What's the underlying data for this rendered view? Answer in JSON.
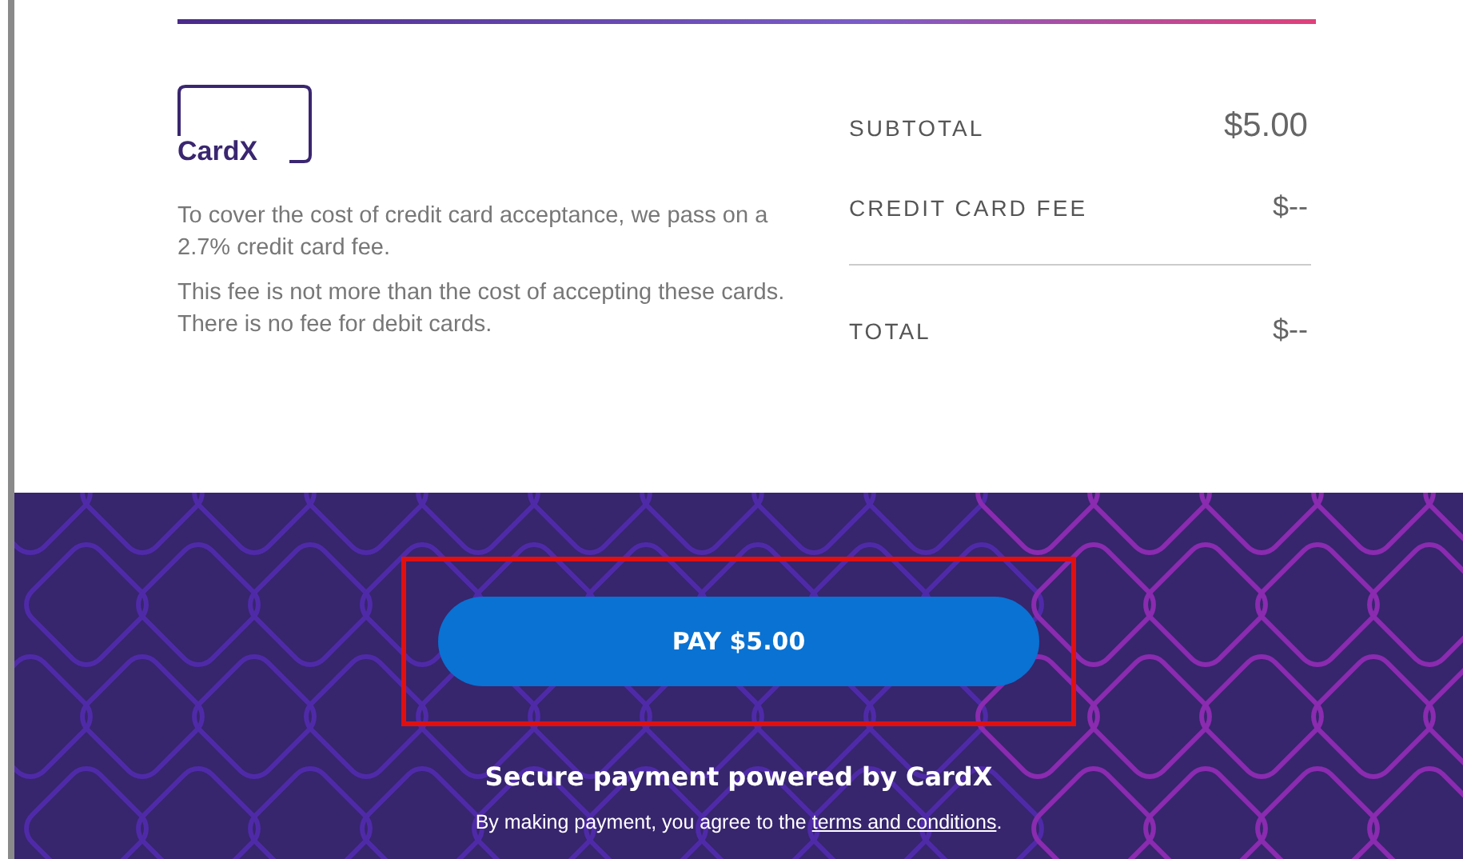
{
  "logo": {
    "text": "CardX"
  },
  "notes": [
    "To cover the cost of credit card acceptance, we pass on a 2.7% credit card fee.",
    "This fee is not more than the cost of accepting these cards. There is no fee for debit cards."
  ],
  "summary": [
    {
      "label": "SUBTOTAL",
      "value": "$5.00",
      "kind": "line"
    },
    {
      "label": "CREDIT CARD FEE",
      "value": "$--",
      "kind": "line"
    },
    {
      "label": "TOTAL",
      "value": "$--",
      "kind": "total"
    }
  ],
  "pay_button": {
    "label": "PAY $5.00",
    "highlighted": true
  },
  "secure_text": "Secure payment powered by CardX",
  "terms": {
    "before": "By making payment, you agree to the ",
    "link": "terms and conditions",
    "after": "."
  }
}
